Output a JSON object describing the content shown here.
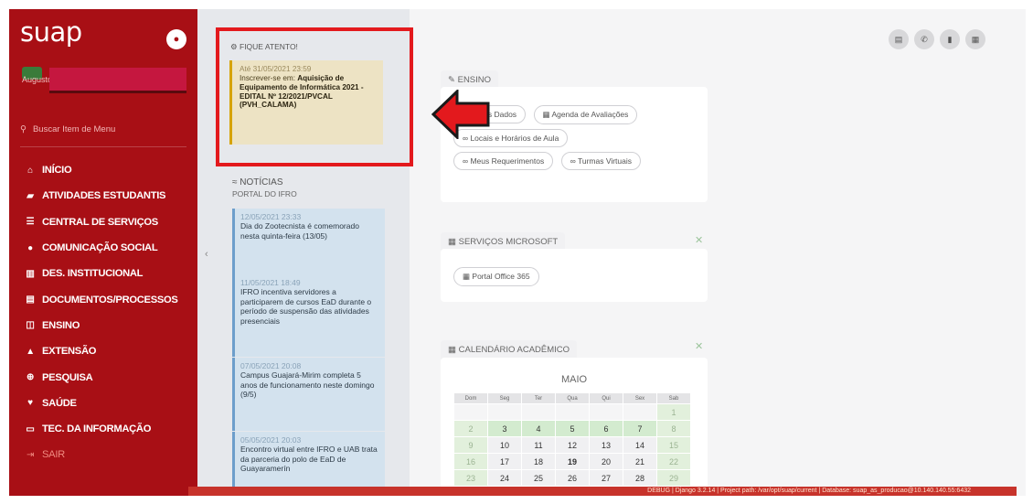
{
  "app": {
    "logo": "suap"
  },
  "user": {
    "name": "Augusto"
  },
  "sidebar": {
    "search_label": "Buscar Item de Menu",
    "items": [
      {
        "label": "INÍCIO",
        "icon": "home-icon",
        "glyph": "⌂"
      },
      {
        "label": "ATIVIDADES ESTUDANTIS",
        "icon": "graduation-cap-icon",
        "glyph": "▰"
      },
      {
        "label": "CENTRAL DE SERVIÇOS",
        "icon": "list-icon",
        "glyph": "☰"
      },
      {
        "label": "COMUNICAÇÃO SOCIAL",
        "icon": "comment-icon",
        "glyph": "●"
      },
      {
        "label": "DES. INSTITUCIONAL",
        "icon": "chart-icon",
        "glyph": "▥"
      },
      {
        "label": "DOCUMENTOS/PROCESSOS",
        "icon": "document-icon",
        "glyph": "▤"
      },
      {
        "label": "ENSINO",
        "icon": "chalkboard-icon",
        "glyph": "◫"
      },
      {
        "label": "EXTENSÃO",
        "icon": "building-icon",
        "glyph": "▲"
      },
      {
        "label": "PESQUISA",
        "icon": "globe-icon",
        "glyph": "⊕"
      },
      {
        "label": "SAÚDE",
        "icon": "heart-icon",
        "glyph": "♥"
      },
      {
        "label": "TEC. DA INFORMAÇÃO",
        "icon": "monitor-icon",
        "glyph": "▭"
      },
      {
        "label": "SAIR",
        "icon": "logout-icon",
        "glyph": "⇥"
      }
    ]
  },
  "alert": {
    "header": "FIQUE ATENTO!",
    "timestamp": "Até 31/05/2021 23:59",
    "prefix": "Inscrever-se em: ",
    "title": "Aquisição de Equipamento de Informática 2021 - EDITAL Nº 12/2021/PVCAL (PVH_CALAMA)"
  },
  "news": {
    "header": "NOTÍCIAS",
    "subheader": "PORTAL DO IFRO",
    "items": [
      {
        "ts": "12/05/2021 23:33",
        "text": "Dia do Zootecnista é comemorado nesta quinta-feira (13/05)"
      },
      {
        "ts": "11/05/2021 18:49",
        "text": "IFRO incentiva servidores a participarem de cursos EaD durante o período de suspensão das atividades presenciais"
      },
      {
        "ts": "07/05/2021 20:08",
        "text": "Campus Guajará-Mirim completa 5 anos de funcionamento neste domingo (9/5)"
      },
      {
        "ts": "05/05/2021 20:03",
        "text": "Encontro virtual entre IFRO e UAB trata da parceria do polo de EaD de Guayaramerín"
      }
    ]
  },
  "ensino": {
    "title": "ENSINO",
    "links": [
      "Meus Dados",
      "Agenda de Avaliações",
      "Locais e Horários de Aula",
      "Meus Requerimentos",
      "Turmas Virtuais"
    ]
  },
  "microsoft": {
    "title": "SERVIÇOS MICROSOFT",
    "links": [
      "Portal Office 365"
    ]
  },
  "calendar": {
    "title": "CALENDÁRIO ACADÊMICO",
    "month": "MAIO",
    "weekdays": [
      "Dom",
      "Seg",
      "Ter",
      "Qua",
      "Qui",
      "Sex",
      "Sab"
    ],
    "weeks": [
      [
        "",
        "",
        "",
        "",
        "",
        "",
        "1"
      ],
      [
        "2",
        "3",
        "4",
        "5",
        "6",
        "7",
        "8"
      ],
      [
        "9",
        "10",
        "11",
        "12",
        "13",
        "14",
        "15"
      ],
      [
        "16",
        "17",
        "18",
        "19",
        "20",
        "21",
        "22"
      ],
      [
        "23",
        "24",
        "25",
        "26",
        "27",
        "28",
        "29"
      ]
    ],
    "today": "19"
  },
  "footer": {
    "text": "DEBUG | Django 3.2.14 | Project path: /var/opt/suap/current | Database: suap_as_producao@10.140.140.55:6432"
  },
  "colors": {
    "sidebar": "#a80f15",
    "highlight": "#e3191d",
    "footer": "#c7332b"
  }
}
